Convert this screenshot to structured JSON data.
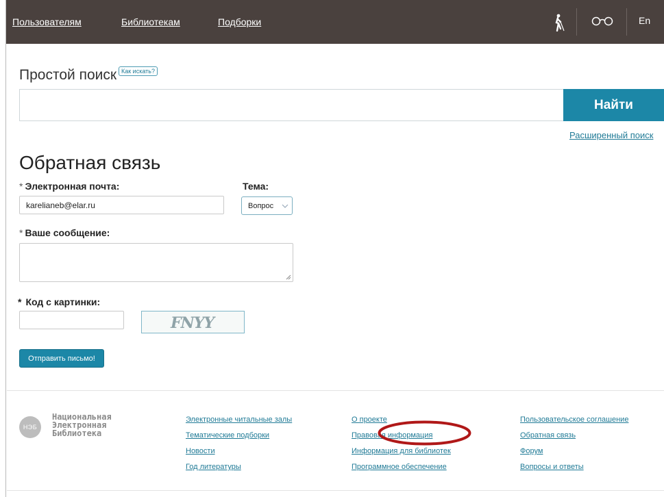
{
  "nav": {
    "users": "Пользователям",
    "libraries": "Библиотекам",
    "collections": "Подборки",
    "lang": "En",
    "icons": [
      "blind-accessibility-icon",
      "glasses-icon"
    ]
  },
  "search": {
    "title": "Простой поиск",
    "howto": "Как искать?",
    "query": "",
    "button": "Найти",
    "advanced": "Расширенный поиск"
  },
  "feedback": {
    "title": "Обратная связь",
    "required_mark": "*",
    "email_label": "Электронная почта:",
    "email_value": "karelianeb@elar.ru",
    "topic_label": "Тема:",
    "topic_value": "Вопрос",
    "message_label": "Ваше сообщение:",
    "code_label": "Код с картинки:",
    "captcha_text": "FNYY",
    "submit": "Отправить письмо!"
  },
  "footer": {
    "logo_abbr": "НЭБ",
    "org_name": [
      "Национальная",
      "Электронная",
      "Библиотека"
    ],
    "col1": [
      "Электронные читальные залы",
      "Тематические подборки",
      "Новости",
      "Год литературы"
    ],
    "col2": [
      "О проекте",
      "Правовая информация",
      "Информация для библиотек",
      "Программное обеспечение"
    ],
    "col3": [
      "Пользовательское соглашение",
      "Обратная связь",
      "Форум",
      "Вопросы и ответы"
    ]
  },
  "colors": {
    "topbar": "#4a413e",
    "accent": "#1c87a7",
    "link": "#1f7a96",
    "annotation": "#b01818"
  }
}
